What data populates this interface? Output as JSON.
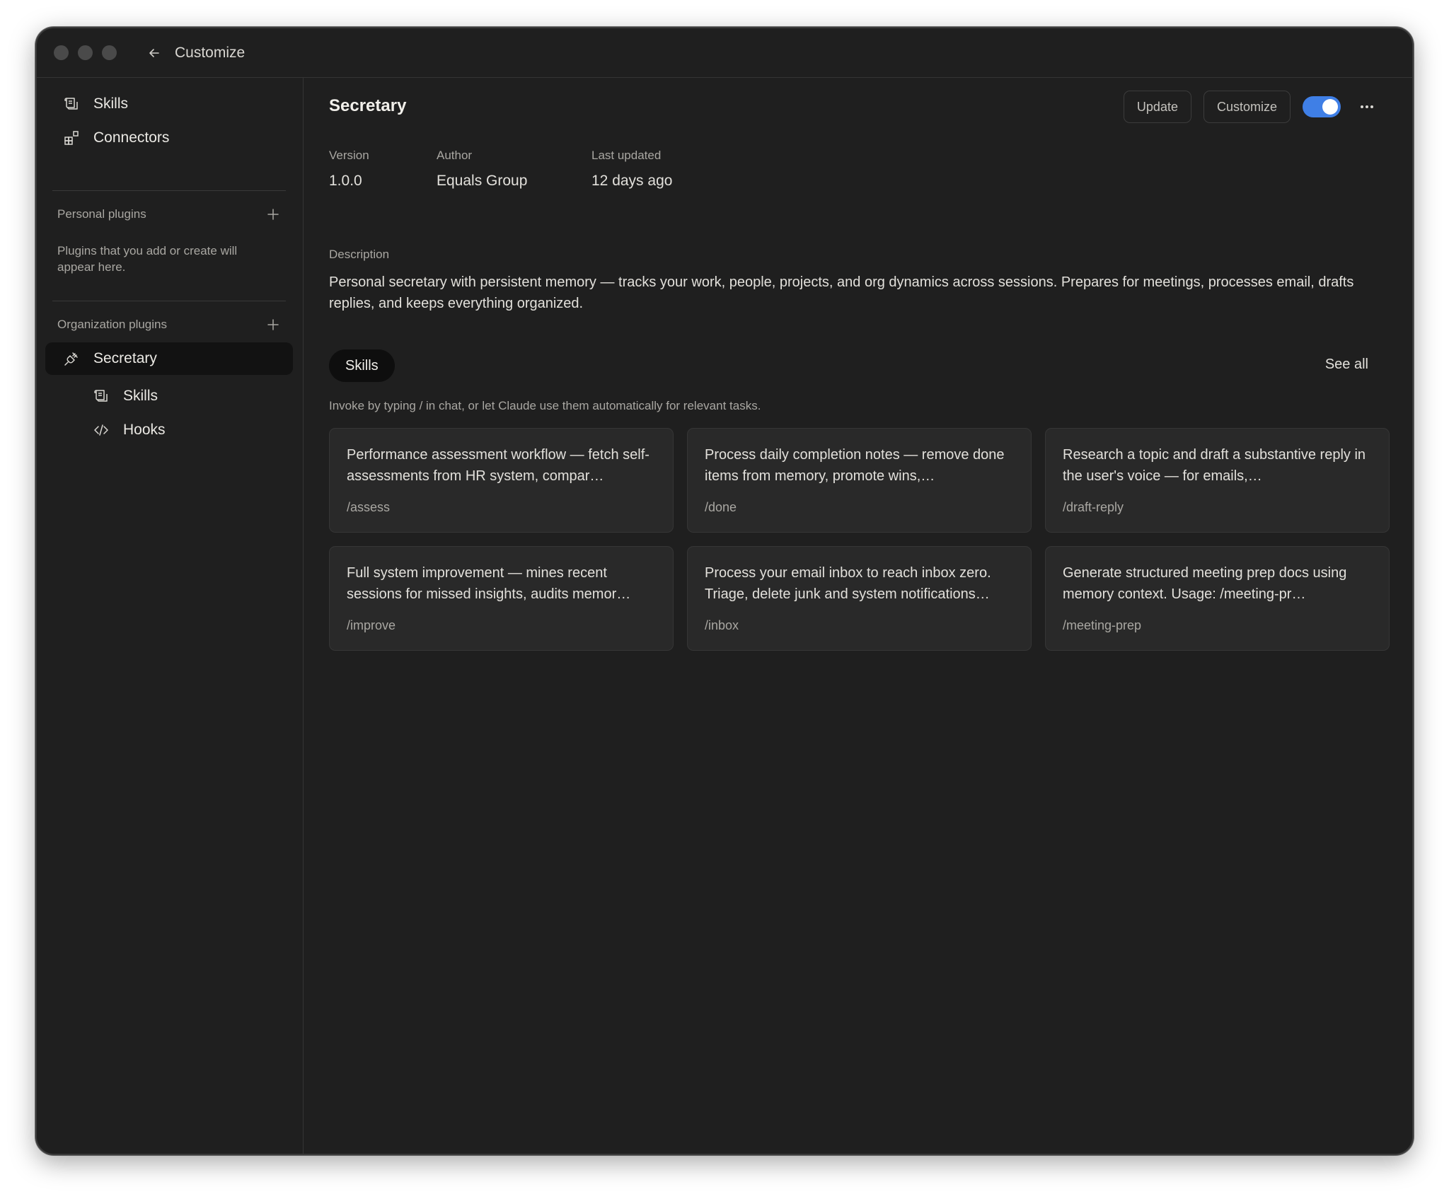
{
  "window": {
    "title": "Customize"
  },
  "sidebar": {
    "top_items": [
      {
        "label": "Skills",
        "icon": "skills-icon"
      },
      {
        "label": "Connectors",
        "icon": "connectors-icon"
      }
    ],
    "personal": {
      "header": "Personal plugins",
      "hint": "Plugins that you add or create will appear here."
    },
    "organization": {
      "header": "Organization plugins",
      "active_plugin": "Secretary",
      "sub_items": [
        {
          "label": "Skills",
          "icon": "skills-icon"
        },
        {
          "label": "Hooks",
          "icon": "code-icon"
        }
      ]
    }
  },
  "plugin": {
    "name": "Secretary",
    "actions": {
      "update": "Update",
      "customize": "Customize",
      "enabled": true
    },
    "meta": {
      "version_label": "Version",
      "version": "1.0.0",
      "author_label": "Author",
      "author": "Equals Group",
      "updated_label": "Last updated",
      "updated": "12 days ago"
    },
    "description_label": "Description",
    "description": "Personal secretary with persistent memory — tracks your work, people, projects, and org dynamics across sessions. Prepares for meetings, processes email, drafts replies, and keeps everything organized.",
    "tab": "Skills",
    "see_all": "See all",
    "invoke_hint": "Invoke by typing / in chat, or let Claude use them automatically for relevant tasks.",
    "skills": [
      {
        "desc": "Performance assessment workflow — fetch self-assessments from HR system, compar…",
        "cmd": "/assess"
      },
      {
        "desc": "Process daily completion notes — remove done items from memory, promote wins,…",
        "cmd": "/done"
      },
      {
        "desc": "Research a topic and draft a substantive reply in the user's voice — for emails,…",
        "cmd": "/draft-reply"
      },
      {
        "desc": "Full system improvement — mines recent sessions for missed insights, audits memor…",
        "cmd": "/improve"
      },
      {
        "desc": "Process your email inbox to reach inbox zero. Triage, delete junk and system notifications…",
        "cmd": "/inbox"
      },
      {
        "desc": "Generate structured meeting prep docs using memory context. Usage: /meeting-pr…",
        "cmd": "/meeting-prep"
      }
    ]
  },
  "colors": {
    "accent": "#3f7fe6",
    "background": "#1f1f1f",
    "card": "#292929"
  }
}
